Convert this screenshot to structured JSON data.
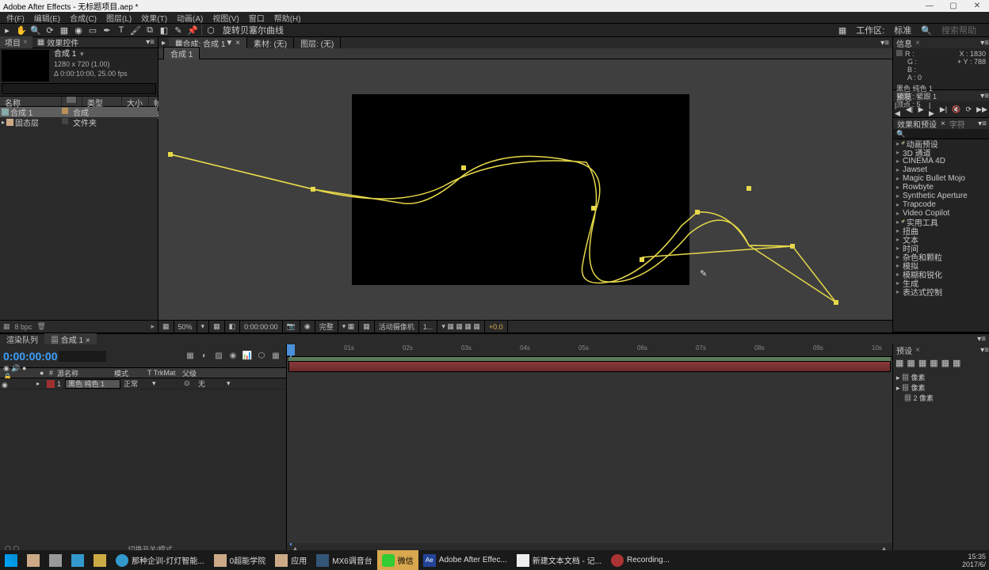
{
  "title": "Adobe After Effects - 无标题项目.aep *",
  "menu": [
    "件(F)",
    "编辑(E)",
    "合成(C)",
    "图层(L)",
    "效果(T)",
    "动画(A)",
    "视图(V)",
    "窗口",
    "帮助(H)"
  ],
  "toolbar_right": {
    "tooltip": "旋转贝塞尔曲线",
    "workspace_label": "工作区:",
    "workspace_value": "标准",
    "search_placeholder": "搜索帮助"
  },
  "project": {
    "tab": "项目",
    "fx_tab": "效果控件",
    "comp_name": "合成 1",
    "dims": "1280 x 720 (1.00)",
    "duration": "Δ 0:00:10:00, 25.00 fps",
    "cols": [
      "名称",
      "类型",
      "大小",
      "帧速"
    ],
    "rows": [
      {
        "name": "合成 1",
        "type": "合成",
        "sel": true,
        "icon": "comp"
      },
      {
        "name": "固态层",
        "type": "文件夹",
        "sel": false,
        "icon": "folder"
      }
    ],
    "bpc": "8 bpc"
  },
  "comp_tabs": [
    {
      "label": "合成: 合成 1",
      "active": true
    },
    {
      "label": "素材: (无)",
      "active": false
    },
    {
      "label": "图层: (无)",
      "active": false
    }
  ],
  "comp_subtab": "合成 1",
  "viewer_footer": {
    "zoom": "50%",
    "time": "0:00:00:00",
    "res": "完整",
    "camera": "活动摄像机",
    "views": "1...",
    "exposure": "+0.0"
  },
  "info": {
    "title": "信息",
    "R": "R :",
    "G": "G :",
    "B": "B :",
    "A": "A : 0",
    "X": "X : 1830",
    "Y": "Y : 788",
    "extra1": "黑色 纯色 1",
    "extra2": "紧跟 : 紧跟 1",
    "extra3": "顶点 : 5"
  },
  "preview": {
    "title": "预览"
  },
  "fx_panel": {
    "tabs": [
      "效果和预设",
      "字符"
    ],
    "items": [
      "* 动画预设",
      "3D 通道",
      "CINEMA 4D",
      "Jawset",
      "Magic Bullet Mojo",
      "Rowbyte",
      "Synthetic Aperture",
      "Trapcode",
      "Video Copilot",
      "* 实用工具",
      "扭曲",
      "文本",
      "时间",
      "杂色和颗粒",
      "模拟",
      "模糊和锐化",
      "生成",
      "表达式控制"
    ]
  },
  "preset_panel": {
    "title": "预设"
  },
  "timeline": {
    "queue_tab": "渲染队列",
    "comp_tab": "合成 1",
    "timecode": "0:00:00:00",
    "cols": {
      "toggles": "",
      "num": "#",
      "source": "源名称",
      "mode": "模式",
      "trkmat": "T TrkMat",
      "parent": "父级"
    },
    "ticks": [
      "01s",
      "02s",
      "03s",
      "04s",
      "05s",
      "06s",
      "07s",
      "08s",
      "09s",
      "10s"
    ],
    "layer": {
      "num": "1",
      "name": "黑色 纯色 1",
      "mode": "正常",
      "parent": "无"
    },
    "footer": "切换开关/模式",
    "right_items": [
      "像素",
      "像素",
      "像素"
    ]
  },
  "taskbar": {
    "items": [
      {
        "name": "start",
        "label": "",
        "color": "#fff"
      },
      {
        "name": "explorer",
        "label": ""
      },
      {
        "name": "calc",
        "label": ""
      },
      {
        "name": "media",
        "label": ""
      },
      {
        "name": "pkg",
        "label": ""
      },
      {
        "name": "ie",
        "label": "那种企训-灯灯智能...",
        "active": false
      },
      {
        "name": "folder1",
        "label": "0超能学院"
      },
      {
        "name": "folder2",
        "label": "应用"
      },
      {
        "name": "mx",
        "label": "MX6调音台"
      },
      {
        "name": "wechat",
        "label": "微信",
        "active": true
      },
      {
        "name": "ae",
        "label": "Adobe After Effec..."
      },
      {
        "name": "notepad",
        "label": "新建文本文档 - 记..."
      },
      {
        "name": "rec",
        "label": "Recording..."
      }
    ],
    "clock": {
      "time": "15:35",
      "date": "2017/6/"
    }
  }
}
